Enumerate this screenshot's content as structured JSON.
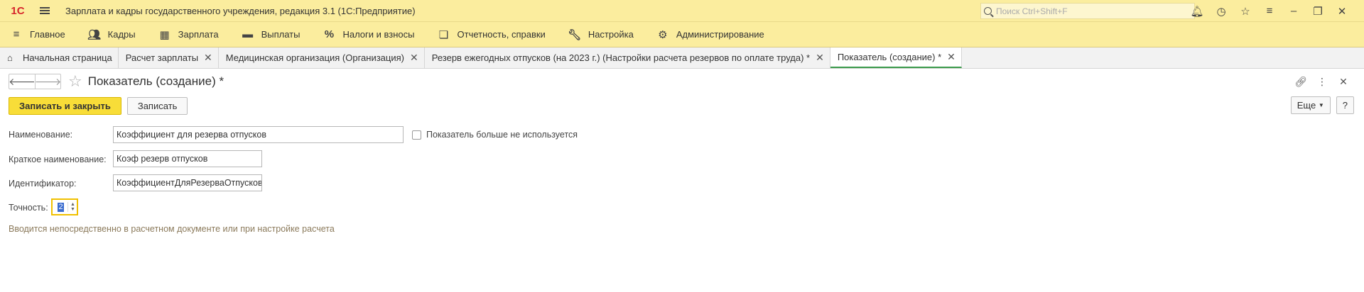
{
  "titlebar": {
    "logo": "1С",
    "title": "Зарплата и кадры государственного учреждения, редакция 3.1  (1С:Предприятие)",
    "search_placeholder": "Поиск Ctrl+Shift+F"
  },
  "sections": [
    {
      "label": "Главное",
      "icon": "hamburger-icon"
    },
    {
      "label": "Кадры",
      "icon": "people-icon"
    },
    {
      "label": "Зарплата",
      "icon": "calculator-icon"
    },
    {
      "label": "Выплаты",
      "icon": "wallet-icon"
    },
    {
      "label": "Налоги и взносы",
      "icon": "percent-icon"
    },
    {
      "label": "Отчетность, справки",
      "icon": "documents-icon"
    },
    {
      "label": "Настройка",
      "icon": "wrench-icon"
    },
    {
      "label": "Администрирование",
      "icon": "gear-icon"
    }
  ],
  "tabs": [
    {
      "label": "Начальная страница"
    },
    {
      "label": "Расчет зарплаты"
    },
    {
      "label": "Медицинская организация (Организация)"
    },
    {
      "label": "Резерв ежегодных отпусков (на 2023 г.) (Настройки расчета резервов по оплате труда) *"
    },
    {
      "label": "Показатель (создание) *"
    }
  ],
  "form": {
    "title": "Показатель (создание) *",
    "save_close_label": "Записать и закрыть",
    "save_label": "Записать",
    "more_label": "Еще",
    "help_label": "?",
    "name_label": "Наименование:",
    "name_value": "Коэффициент для резерва отпусков",
    "unused_label": "Показатель больше не используется",
    "short_name_label": "Краткое наименование:",
    "short_name_value": "Коэф резерв отпусков",
    "id_label": "Идентификатор:",
    "id_value": "КоэффициентДляРезерваОтпусков",
    "precision_label": "Точность:",
    "precision_value": "2",
    "hint": "Вводится непосредственно в расчетном документе или при настройке расчета"
  }
}
